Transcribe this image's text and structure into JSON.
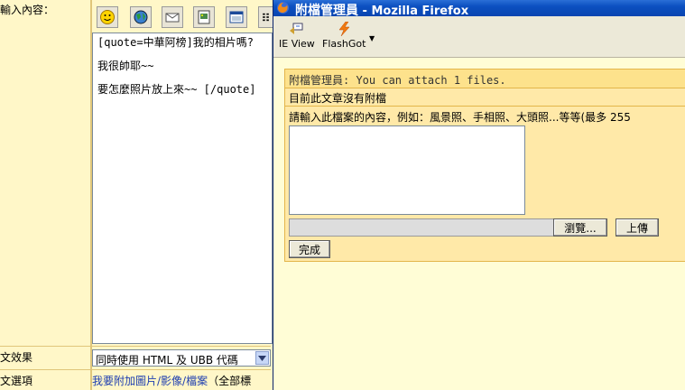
{
  "page": {
    "labels": {
      "content": "輸入內容：",
      "effect": "文效果",
      "options": "文選項"
    },
    "editor": {
      "lines": [
        "[quote=中華阿榜]我的相片嗎?",
        "",
        "我很帥耶~~",
        "",
        "要怎麼照片放上來~~ [/quote]"
      ]
    },
    "toolbar_icons": [
      "smiley-icon",
      "globe-icon",
      "envelope-icon",
      "image-icon",
      "window-icon",
      "list-icon"
    ],
    "mode_select": {
      "value": "同時使用 HTML 及 UBB 代碼"
    },
    "attach_link": {
      "text": "我要附加圖片/影像/檔案",
      "note": "（全部標"
    }
  },
  "popup": {
    "title_prefix": "附檔管理員",
    "title_suffix": " - Mozilla Firefox",
    "toolbar": [
      {
        "label": "IE View",
        "icon": "ie-view-icon"
      },
      {
        "label": "FlashGot",
        "icon": "flashgot-icon"
      }
    ],
    "attach": {
      "header": "附檔管理員: You can attach 1 files.",
      "status": "目前此文章沒有附檔",
      "desc_label": "請輸入此檔案的內容，例如：風景照、手相照、大頭照...等等(最多 255",
      "browse": "瀏覽...",
      "upload": "上傳",
      "done": "完成"
    }
  },
  "colors": {
    "page_bg": "#fff7c8",
    "popup_bg": "#fffdd6",
    "title_blue": "#0b4fc0",
    "panel_header": "#fde28c",
    "panel_body": "#ffe9a8",
    "link": "#1f3fb0"
  }
}
